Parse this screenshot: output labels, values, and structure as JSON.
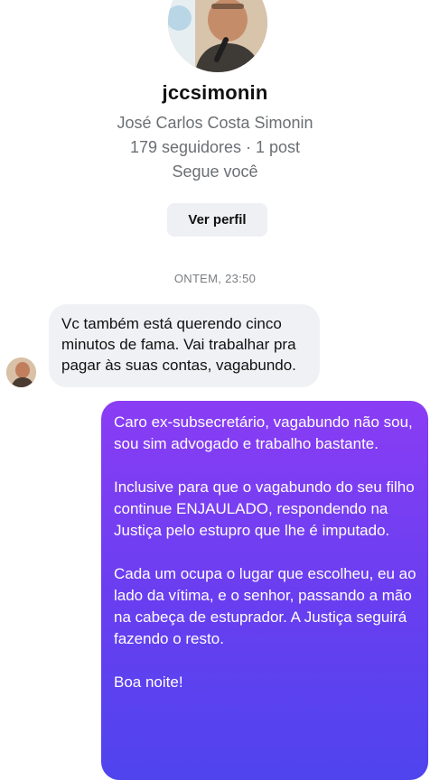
{
  "profile": {
    "username": "jccsimonin",
    "full_name": "José Carlos Costa Simonin",
    "stats": "179 seguidores · 1 post",
    "follows_you": "Segue você",
    "view_profile_label": "Ver perfil"
  },
  "conversation": {
    "timestamp": "ONTEM, 23:50",
    "messages": [
      {
        "direction": "incoming",
        "text": "Vc também está querendo cinco minutos de fama. Vai trabalhar pra pagar às suas contas, vagabundo."
      },
      {
        "direction": "outgoing",
        "paragraphs": [
          "Caro ex-subsecretário, vagabundo não sou, sou sim advogado e trabalho bastante.",
          "Inclusive para que o vagabundo do seu filho continue ENJAULADO, respondendo na Justiça pelo estupro que lhe é imputado.",
          "Cada um ocupa o lugar que escolheu, eu ao lado da vítima, e o senhor, passando a mão na cabeça de estuprador. A Justiça seguirá fazendo o resto.",
          "Boa noite!"
        ]
      }
    ]
  },
  "colors": {
    "incoming_bubble": "#eff1f4",
    "outgoing_gradient_top": "#8a3df4",
    "outgoing_gradient_bottom": "#4f44ee",
    "secondary_text": "#6b6f73"
  },
  "icons": {
    "profile_avatar": "profile-photo-icon",
    "sender_avatar": "sender-avatar-icon"
  }
}
